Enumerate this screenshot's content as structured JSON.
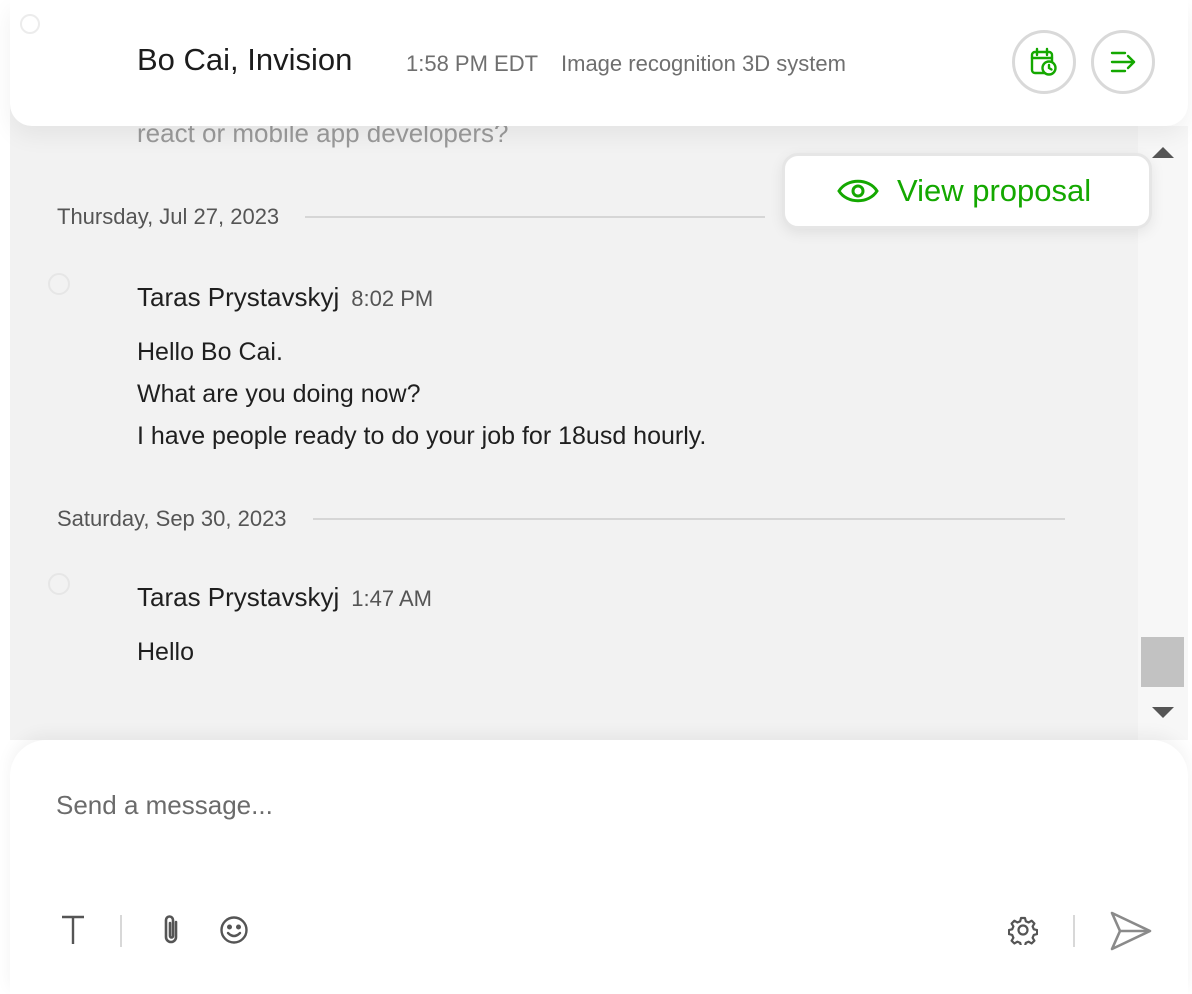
{
  "header": {
    "title": "Bo Cai, Invision",
    "time": "1:58 PM EDT",
    "job": "Image recognition 3D system",
    "schedule_icon": "calendar-clock-icon",
    "details_icon": "side-panel-arrow-icon"
  },
  "feed": {
    "faded_text": "react or mobile app developers?",
    "groups": [
      {
        "date": "Thursday, Jul 27, 2023",
        "sender": "Taras Prystavskyj",
        "time": "8:02 PM",
        "lines": [
          "Hello Bo Cai.",
          "What are you doing now?",
          "I have people ready to do your job for 18usd hourly."
        ]
      },
      {
        "date": "Saturday, Sep 30, 2023",
        "sender": "Taras Prystavskyj",
        "time": "1:47 AM",
        "lines": [
          "Hello"
        ]
      }
    ]
  },
  "proposal": {
    "label": "View proposal",
    "icon": "eye-icon"
  },
  "composer": {
    "placeholder": "Send a message...",
    "tools": [
      "text-format-icon",
      "paperclip-icon",
      "emoji-icon",
      "gear-icon",
      "send-icon"
    ]
  },
  "colors": {
    "accent": "#14a800",
    "feed_bg": "#f2f2f2",
    "muted_text": "#6f6f6f"
  }
}
